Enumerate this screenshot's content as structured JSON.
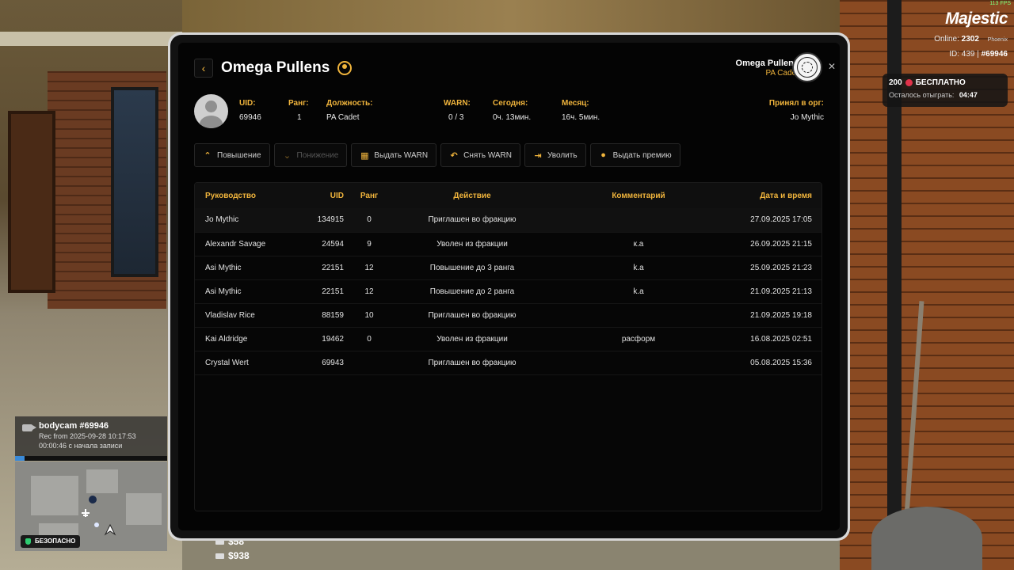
{
  "hud": {
    "fps": "113 FPS",
    "brand": "Majestic",
    "online_label": "Online:",
    "online_count": "2302",
    "server": "Phoenix",
    "id_label": "ID: 439 |",
    "player_id": "#69946",
    "bonus_amount": "200",
    "bonus_text": "БЕСПЛАТНО",
    "bonus_remaining_label": "Осталось отыграть:",
    "bonus_remaining_time": "04:47"
  },
  "bodycam": {
    "title": "bodycam #69946",
    "rec": "Rec from 2025-09-28 10:17:53",
    "elapsed": "00:00:46 с начала записи",
    "safe_label": "БЕЗОПАСНО",
    "cash": "$58",
    "bank": "$938"
  },
  "profile": {
    "name": "Omega Pullens",
    "org_name": "Omega Pullens",
    "org_rank": "PA Cadet",
    "fields": [
      {
        "label": "UID:",
        "value": "69946"
      },
      {
        "label": "Ранг:",
        "value": "1"
      },
      {
        "label": "Должность:",
        "value": "PA Cadet"
      },
      {
        "label": "WARN:",
        "value": "0 / 3"
      },
      {
        "label": "Сегодня:",
        "value": "0ч. 13мин."
      },
      {
        "label": "Месяц:",
        "value": "16ч. 5мин."
      },
      {
        "label": "Принял в орг:",
        "value": "Jo Mythic"
      }
    ]
  },
  "actions": [
    {
      "label": "Повышение",
      "icon": "chevron-up-icon",
      "disabled": false
    },
    {
      "label": "Понижение",
      "icon": "chevron-down-icon",
      "disabled": true
    },
    {
      "label": "Выдать WARN",
      "icon": "warn-doc-icon",
      "disabled": false
    },
    {
      "label": "Снять WARN",
      "icon": "undo-icon",
      "disabled": false
    },
    {
      "label": "Уволить",
      "icon": "fire-person-icon",
      "disabled": false
    },
    {
      "label": "Выдать премию",
      "icon": "coin-icon",
      "disabled": false
    }
  ],
  "log": {
    "headers": [
      "Руководство",
      "UID",
      "Ранг",
      "Действие",
      "Комментарий",
      "Дата и время"
    ],
    "rows": [
      [
        "Jo Mythic",
        "134915",
        "0",
        "Приглашен во фракцию",
        "",
        "27.09.2025 17:05"
      ],
      [
        "Alexandr Savage",
        "24594",
        "9",
        "Уволен из фракции",
        "к.а",
        "26.09.2025 21:15"
      ],
      [
        "Asi Mythic",
        "22151",
        "12",
        "Повышение до 3 ранга",
        "k.a",
        "25.09.2025 21:23"
      ],
      [
        "Asi Mythic",
        "22151",
        "12",
        "Повышение до 2 ранга",
        "k.a",
        "21.09.2025 21:13"
      ],
      [
        "Vladislav Rice",
        "88159",
        "10",
        "Приглашен во фракцию",
        "",
        "21.09.2025 19:18"
      ],
      [
        "Kai Aldridge",
        "19462",
        "0",
        "Уволен из фракции",
        "расформ",
        "16.08.2025 02:51"
      ],
      [
        "Crystal Wert",
        "69943",
        "",
        "Приглашен во фракцию",
        "",
        "05.08.2025 15:36"
      ]
    ]
  },
  "colors": {
    "accent": "#f0b43c",
    "panel": "#040404"
  }
}
